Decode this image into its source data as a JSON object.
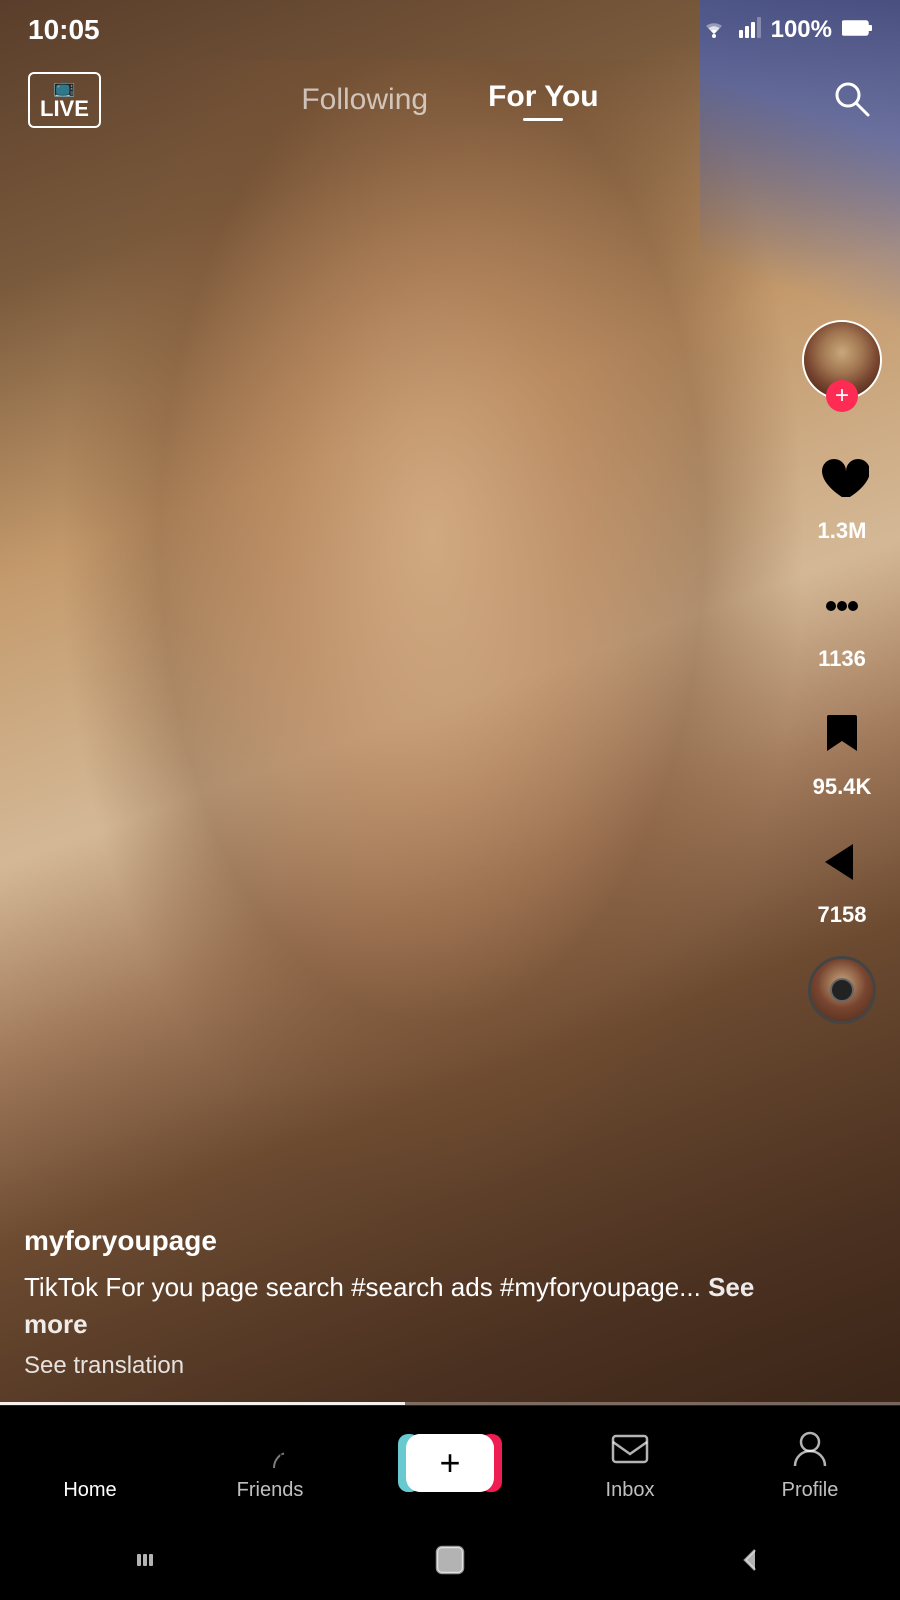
{
  "statusBar": {
    "time": "10:05",
    "battery": "100%"
  },
  "topNav": {
    "liveLabel": "LIVE",
    "tabs": [
      {
        "id": "following",
        "label": "Following",
        "active": false
      },
      {
        "id": "foryou",
        "label": "For You",
        "active": true
      }
    ],
    "searchAriaLabel": "Search"
  },
  "video": {
    "username": "myforyoupage",
    "caption": "TikTok For you page search #search ads #myforyoupage...",
    "seeMore": "See more",
    "translation": "See translation"
  },
  "actions": {
    "likes": "1.3M",
    "comments": "1136",
    "bookmarks": "95.4K",
    "shares": "7158"
  },
  "bottomNav": {
    "items": [
      {
        "id": "home",
        "label": "Home",
        "active": true
      },
      {
        "id": "friends",
        "label": "Friends",
        "active": false
      },
      {
        "id": "add",
        "label": "",
        "active": false
      },
      {
        "id": "inbox",
        "label": "Inbox",
        "active": false
      },
      {
        "id": "profile",
        "label": "Profile",
        "active": false
      }
    ]
  },
  "android": {
    "backLabel": "←",
    "homeLabel": "○",
    "recentLabel": "|||"
  }
}
